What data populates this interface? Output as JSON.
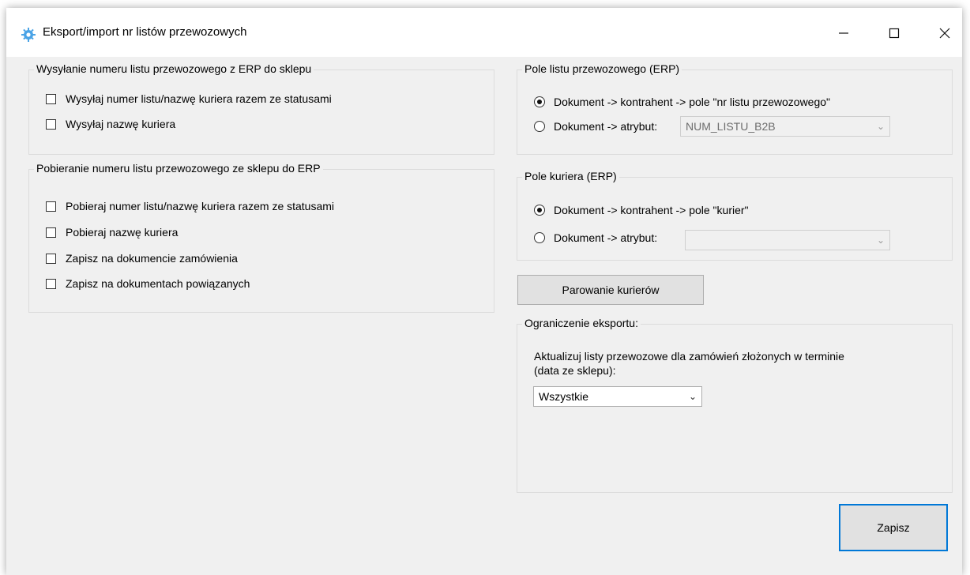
{
  "window": {
    "title": "Eksport/import nr listów przewozowych",
    "icon": "gear-icon"
  },
  "send_group": {
    "title": "Wysyłanie numeru listu przewozowego z ERP do sklepu",
    "items": [
      {
        "label": "Wysyłaj numer listu/nazwę kuriera razem ze statusami",
        "checked": false
      },
      {
        "label": "Wysyłaj nazwę kuriera",
        "checked": false
      }
    ]
  },
  "fetch_group": {
    "title": "Pobieranie numeru listu przewozowego ze sklepu do ERP",
    "items": [
      {
        "label": "Pobieraj numer listu/nazwę kuriera razem ze statusami",
        "checked": false
      },
      {
        "label": "Pobieraj nazwę kuriera",
        "checked": false
      },
      {
        "label": "Zapisz na dokumencie zamówienia",
        "checked": false
      },
      {
        "label": "Zapisz na dokumentach powiązanych",
        "checked": false
      }
    ]
  },
  "waybill_field_group": {
    "title": "Pole listu przewozowego (ERP)",
    "option1_label": "Dokument -> kontrahent -> pole \"nr listu przewozowego\"",
    "option2_label": "Dokument -> atrybut:",
    "selected": 1,
    "attribute_value": "NUM_LISTU_B2B"
  },
  "courier_field_group": {
    "title": "Pole kuriera (ERP)",
    "option1_label": "Dokument -> kontrahent -> pole \"kurier\"",
    "option2_label": "Dokument -> atrybut:",
    "selected": 1,
    "attribute_value": ""
  },
  "pair_button": {
    "label": "Parowanie kurierów"
  },
  "export_limit_group": {
    "title": "Ograniczenie eksportu:",
    "description_line1": "Aktualizuj listy przewozowe dla zamówień złożonych w terminie",
    "description_line2": "(data ze sklepu):",
    "selected_option": "Wszystkie"
  },
  "save_button": {
    "label": "Zapisz"
  },
  "colors": {
    "accent": "#0078d7",
    "background": "#f0f0f0"
  }
}
